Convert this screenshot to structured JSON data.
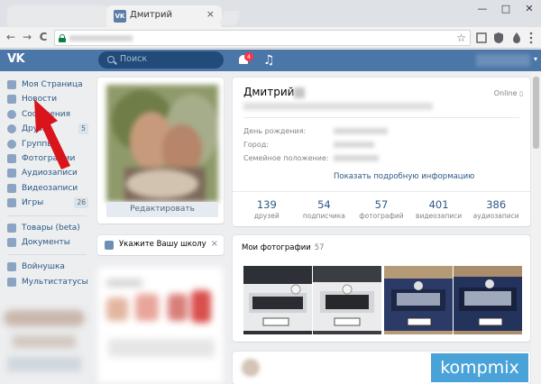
{
  "browser": {
    "tab_title": "Дмитрий",
    "tab_favicon": "VK",
    "tab_close": "×",
    "window_controls": {
      "minimize": "—",
      "maximize": "□",
      "close": "✕"
    },
    "nav": {
      "back": "←",
      "forward": "→",
      "reload": "C"
    },
    "star": "☆"
  },
  "header": {
    "logo": "VK",
    "search_placeholder": "Поиск",
    "notifications_count": "4",
    "accent_color": "#4a76a8"
  },
  "menu": {
    "items": [
      {
        "label": "Моя Страница",
        "icon": "home-icon"
      },
      {
        "label": "Новости",
        "icon": "news-icon"
      },
      {
        "label": "Сообщения",
        "icon": "message-icon"
      },
      {
        "label": "Друзья",
        "icon": "friends-icon",
        "count": "5"
      },
      {
        "label": "Группы",
        "icon": "groups-icon"
      },
      {
        "label": "Фотографии",
        "icon": "camera-icon"
      },
      {
        "label": "Аудиозаписи",
        "icon": "music-icon"
      },
      {
        "label": "Видеозаписи",
        "icon": "video-icon"
      },
      {
        "label": "Игры",
        "icon": "games-icon",
        "count": "26"
      }
    ],
    "items2": [
      {
        "label": "Товары (beta)",
        "icon": "bag-icon"
      },
      {
        "label": "Документы",
        "icon": "document-icon"
      }
    ],
    "items3": [
      {
        "label": "Войнушка",
        "icon": "app-icon"
      },
      {
        "label": "Мультистатусы",
        "icon": "app-icon"
      }
    ]
  },
  "profile": {
    "edit_button": "Редактировать",
    "name": "Дмитрий",
    "online": "Online",
    "fields": [
      {
        "label": "День рождения:"
      },
      {
        "label": "Город:"
      },
      {
        "label": "Семейное положение:"
      }
    ],
    "more_info": "Показать подробную информацию",
    "counters": [
      {
        "num": "139",
        "label": "друзей"
      },
      {
        "num": "54",
        "label": "подписчика"
      },
      {
        "num": "57",
        "label": "фотографий"
      },
      {
        "num": "401",
        "label": "видеозаписи"
      },
      {
        "num": "386",
        "label": "аудиозаписи"
      }
    ]
  },
  "school": {
    "text": "Укажите Вашу школу",
    "close": "×"
  },
  "photos": {
    "title": "Мои фотографии",
    "count": "57"
  },
  "watermark": "kompmix"
}
